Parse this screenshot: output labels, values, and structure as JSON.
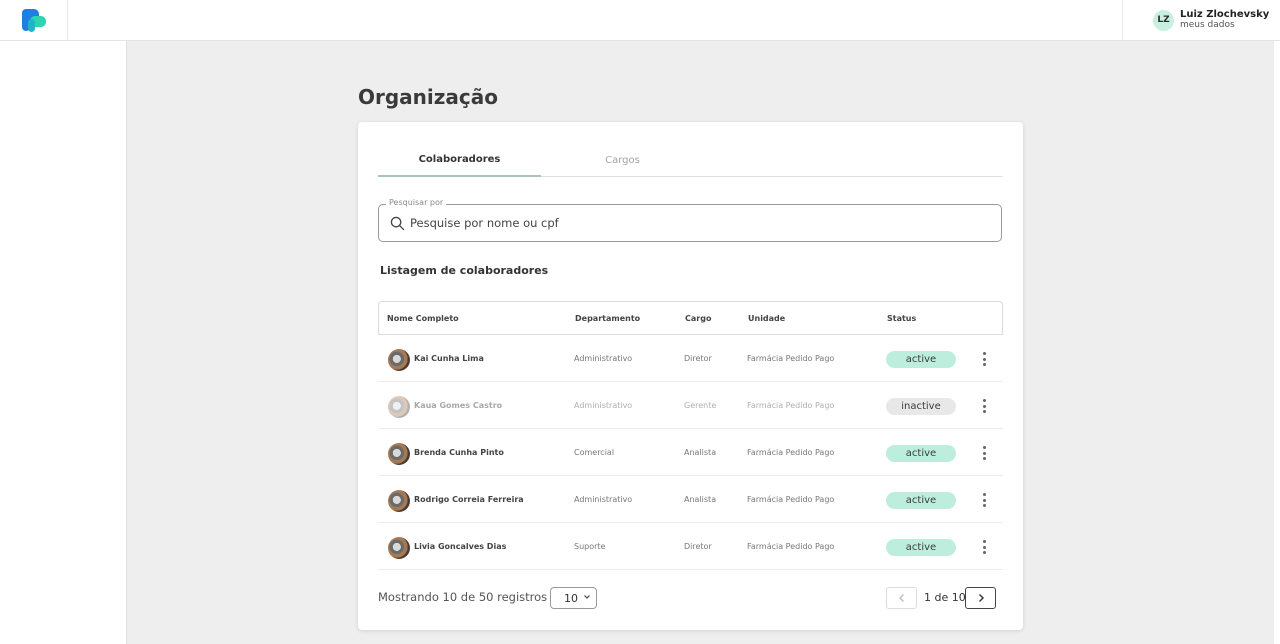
{
  "header": {
    "user_initials": "LZ",
    "user_name": "Luiz Zlochevsky",
    "user_sub": "meus dados"
  },
  "page": {
    "title": "Organização"
  },
  "tabs": [
    {
      "label": "Colaboradores",
      "active": true
    },
    {
      "label": "Cargos",
      "active": false
    }
  ],
  "search": {
    "legend": "Pesquisar por",
    "placeholder": "Pesquise por nome ou cpf"
  },
  "list": {
    "title": "Listagem de colaboradores",
    "columns": [
      "Nome Completo",
      "Departamento",
      "Cargo",
      "Unidade",
      "Status"
    ],
    "rows": [
      {
        "name": "Kai Cunha Lima",
        "department": "Administrativo",
        "role": "Diretor",
        "unit": "Farmácia Pedido Pago",
        "status": "active"
      },
      {
        "name": "Kaua Gomes Castro",
        "department": "Administrativo",
        "role": "Gerente",
        "unit": "Farmácia Pedido Pago",
        "status": "inactive"
      },
      {
        "name": "Brenda Cunha Pinto",
        "department": "Comercial",
        "role": "Analista",
        "unit": "Farmácia Pedido Pago",
        "status": "active"
      },
      {
        "name": "Rodrigo Correia Ferreira",
        "department": "Administrativo",
        "role": "Analista",
        "unit": "Farmácia Pedido Pago",
        "status": "active"
      },
      {
        "name": "Livia Goncalves Dias",
        "department": "Suporte",
        "role": "Diretor",
        "unit": "Farmácia Pedido Pago",
        "status": "active"
      }
    ]
  },
  "footer": {
    "showing": "Mostrando 10 de 50 registros",
    "per_page": "10",
    "page_indicator": "1 de 10"
  },
  "colors": {
    "active_badge": "#bdeedd",
    "inactive_badge": "#e8e8e8",
    "logo_blue": "#1e88e5",
    "logo_teal": "#2ed3b0"
  }
}
